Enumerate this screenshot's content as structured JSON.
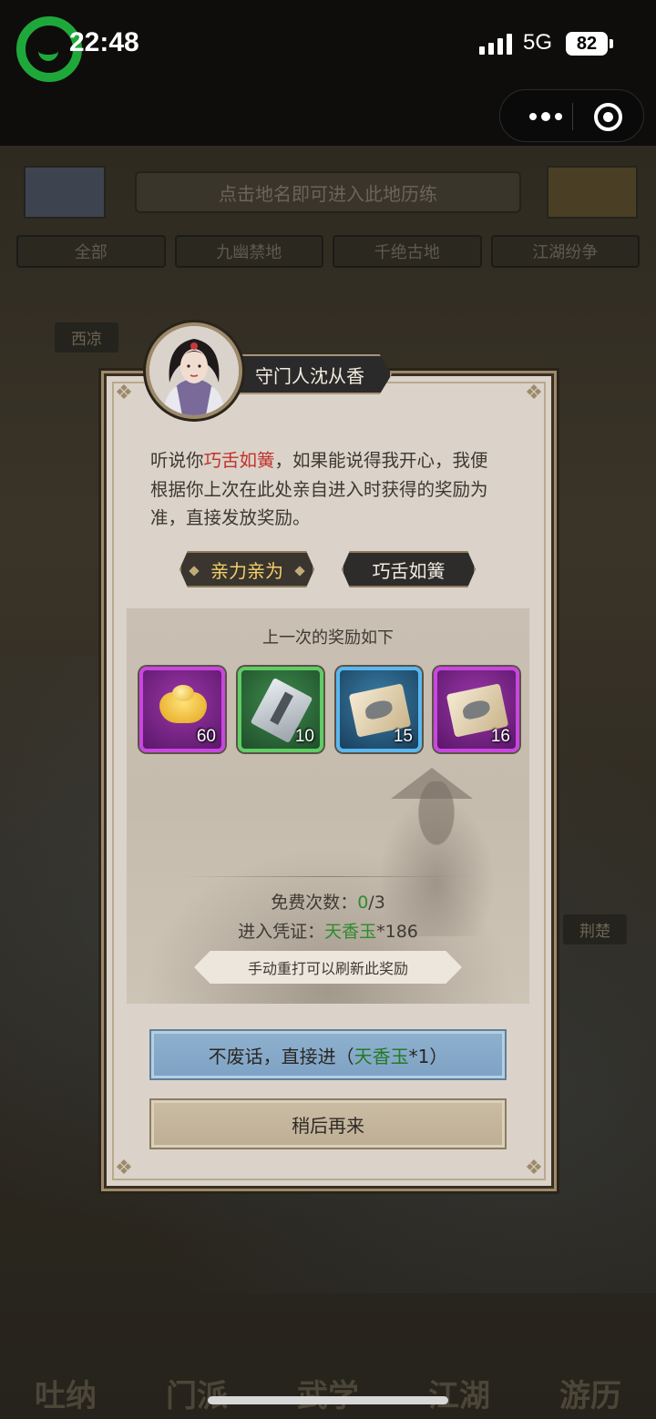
{
  "status_bar": {
    "time": "22:48",
    "network": "5G",
    "battery": "82"
  },
  "background_map": {
    "banner": "点击地名即可进入此地历练",
    "tabs": [
      "全部",
      "九幽禁地",
      "千绝古地",
      "江湖纷争"
    ],
    "place_labels": [
      "西凉",
      "荆楚"
    ],
    "bottom_nav": [
      "吐纳",
      "门派",
      "武学",
      "江湖",
      "游历"
    ]
  },
  "dialog": {
    "speaker": "守门人沈从香",
    "text_before": "听说你",
    "text_highlight": "巧舌如簧",
    "text_after": "，如果能说得我开心，我便根据你上次在此处亲自进入时获得的奖励为准，直接发放奖励。",
    "choices": [
      {
        "label": "亲力亲为",
        "active": true
      },
      {
        "label": "巧舌如簧",
        "active": false
      }
    ],
    "reward_title": "上一次的奖励如下",
    "rewards": [
      {
        "icon": "gold-ingot-icon",
        "count": "60",
        "quality": "purple"
      },
      {
        "icon": "manual-book-icon",
        "count": "10",
        "quality": "green"
      },
      {
        "icon": "map-scroll-icon",
        "count": "15",
        "quality": "blue"
      },
      {
        "icon": "map-scroll-icon",
        "count": "16",
        "quality": "purple"
      }
    ],
    "free_times_label": "免费次数：",
    "free_times_used": "0",
    "free_times_total": "/3",
    "ticket_label": "进入凭证：",
    "ticket_item": "天香玉",
    "ticket_count": "*186",
    "hint": "手动重打可以刷新此奖励",
    "main_button_prefix": "不废话，直接进（",
    "main_button_item": "天香玉",
    "main_button_suffix": "*1）",
    "later_button": "稍后再来"
  },
  "colors": {
    "highlight_red": "#c0312b",
    "highlight_green": "#2e8b2e",
    "active_choice_text": "#f2cf6a",
    "main_button": "#8fb1cf"
  }
}
